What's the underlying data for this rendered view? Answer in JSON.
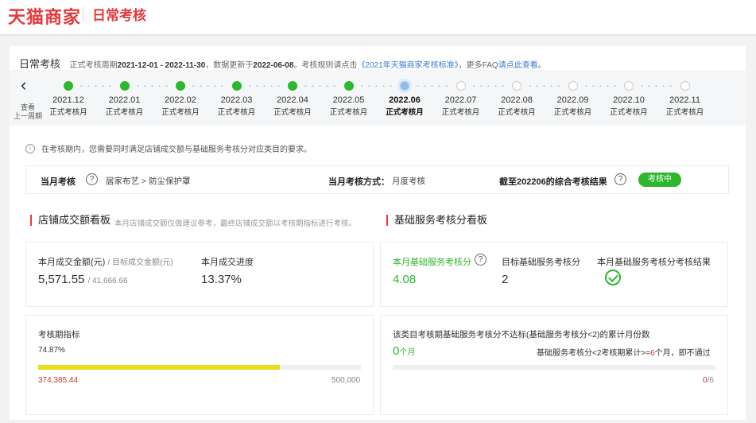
{
  "header": {
    "logo_text": "天猫商家",
    "page_title": "日常考核"
  },
  "summary": {
    "title": "日常考核",
    "period_prefix": "正式考核周期",
    "period": "2021-12-01 - 2022-11-30",
    "updated_prefix": "，数据更新于",
    "updated": "2022-06-08",
    "rule_prefix": "。考核规则请点击",
    "rule_link": "《2021年天猫商家考核标准》",
    "faq_prefix": "，更多FAQ",
    "faq_link": "请点此查看",
    "faq_suffix": "。"
  },
  "timeline": {
    "back_label_1": "查看",
    "back_label_2": "上一周期",
    "months": [
      {
        "date": "2021.12",
        "status": "正式考核月",
        "state": "done"
      },
      {
        "date": "2022.01",
        "status": "正式考核月",
        "state": "done"
      },
      {
        "date": "2022.02",
        "status": "正式考核月",
        "state": "done"
      },
      {
        "date": "2022.03",
        "status": "正式考核月",
        "state": "done"
      },
      {
        "date": "2022.04",
        "status": "正式考核月",
        "state": "done"
      },
      {
        "date": "2022.05",
        "status": "正式考核月",
        "state": "done"
      },
      {
        "date": "2022.06",
        "status": "正式考核月",
        "state": "current"
      },
      {
        "date": "2022.07",
        "status": "正式考核月",
        "state": "future"
      },
      {
        "date": "2022.08",
        "status": "正式考核月",
        "state": "future"
      },
      {
        "date": "2022.09",
        "status": "正式考核月",
        "state": "future"
      },
      {
        "date": "2022.10",
        "status": "正式考核月",
        "state": "future"
      },
      {
        "date": "2022.11",
        "status": "正式考核月",
        "state": "future"
      }
    ]
  },
  "notice": {
    "text": "在考核期内，您需要同时满足店铺成交额与基础服务考核分对应类目的要求。"
  },
  "assess": {
    "month_label": "当月考核",
    "category": "居家布艺 > 防尘保护罩",
    "method_label": "当月考核方式：",
    "method": "月度考核",
    "result_label": "截至202206的综合考核结果",
    "result_badge": "考核中"
  },
  "sales": {
    "title": "店铺成交额看板",
    "subtitle": "本月店铺成交额仅做建议参考，最终店铺成交额以考核期指标进行考核。",
    "amount_label": "本月成交金额(元)",
    "target_label": "/ 目标成交金额(元)",
    "amount": "5,571.55",
    "target": "/ 41,666.66",
    "progress_label": "本月成交进度",
    "progress": "13.37%",
    "period_label": "考核期指标",
    "period_percent": "74.87%",
    "period_fill": 0.7487,
    "period_value": "374,385.44",
    "period_target": "500,000"
  },
  "service": {
    "title": "基础服务考核分看板",
    "score_label": "本月基础服务考核分",
    "score": "4.08",
    "target_label": "目标基础服务考核分",
    "target": "2",
    "result_label": "本月基础服务考核分考核结果",
    "fail_label": "该类目考核期基础服务考核分不达标(基础服务考核分<2)的累计月份数",
    "fail_count": "0",
    "fail_unit": "个月",
    "fail_rule_1": "基础服务考核分<2考核期累计>=",
    "fail_rule_num": "6",
    "fail_rule_2": "个月，即不通过",
    "fail_ratio_num": "0",
    "fail_ratio_den": "/6",
    "fail_fill": 0
  },
  "colors": {
    "brand": "#e4393c",
    "success": "#2db72d",
    "link": "#3a7bd5",
    "bar": "#e8df1e"
  }
}
